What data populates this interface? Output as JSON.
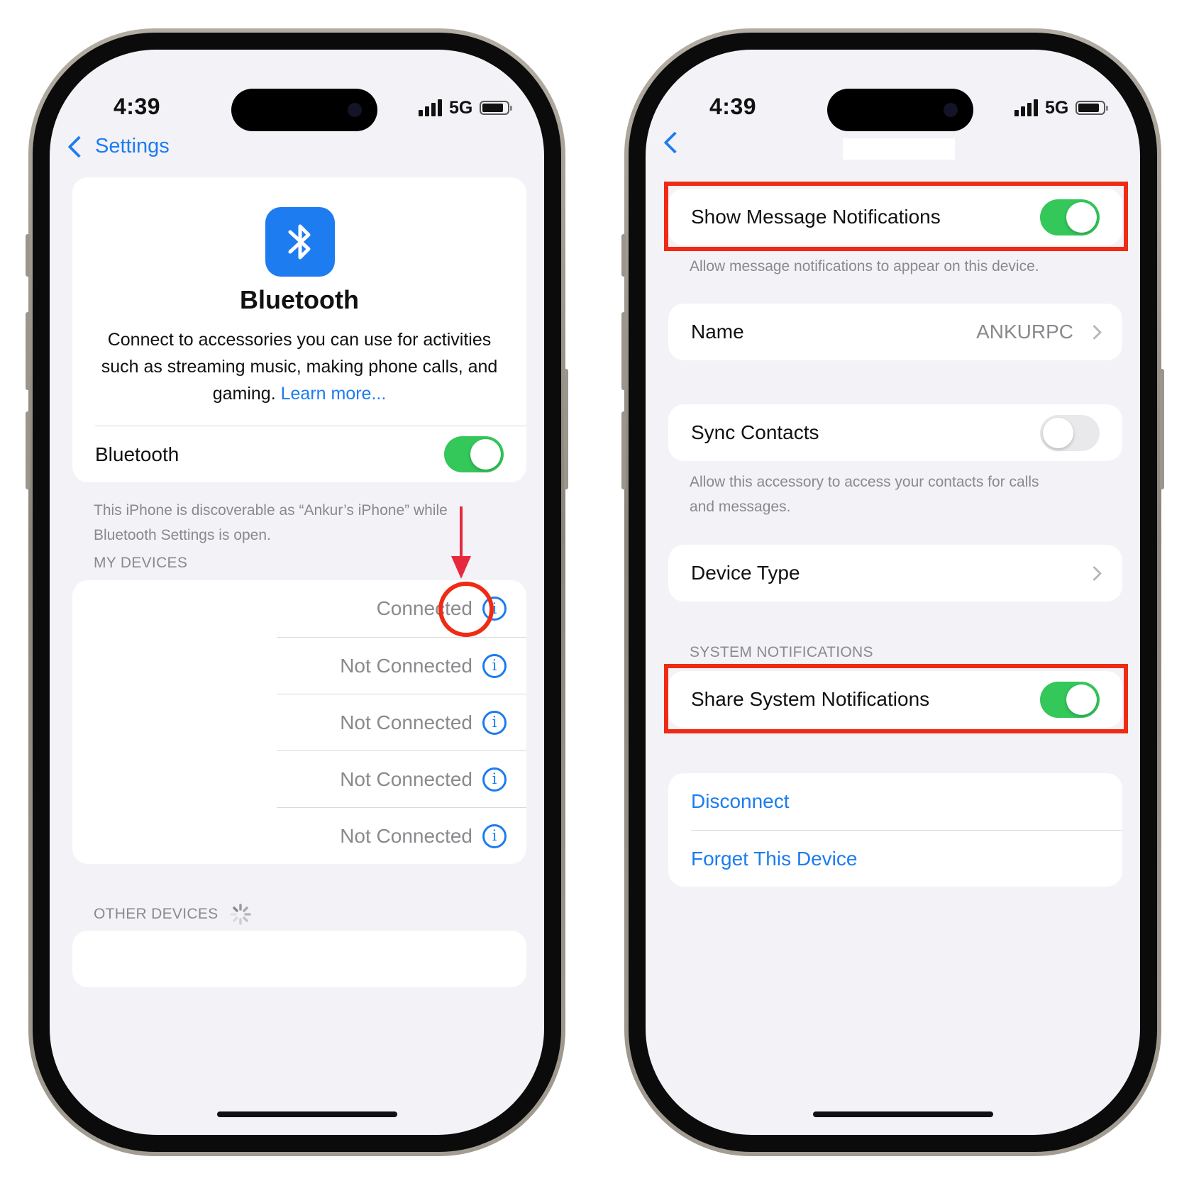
{
  "status": {
    "time": "4:39",
    "network": "5G"
  },
  "left": {
    "back_label": "Settings",
    "hero_title": "Bluetooth",
    "hero_desc_line1": "Connect to accessories you can use for activities",
    "hero_desc_line2": "such as streaming music, making phone calls, and",
    "hero_desc_line3": "gaming.",
    "learn_more": "Learn more...",
    "bluetooth_label": "Bluetooth",
    "bluetooth_on": true,
    "discoverable_line1": "This iPhone is discoverable as “Ankur’s iPhone” while",
    "discoverable_line2": "Bluetooth Settings is open.",
    "my_devices_header": "MY DEVICES",
    "devices": [
      {
        "status": "Connected"
      },
      {
        "status": "Not Connected"
      },
      {
        "status": "Not Connected"
      },
      {
        "status": "Not Connected"
      },
      {
        "status": "Not Connected"
      }
    ],
    "other_devices_header": "OTHER DEVICES"
  },
  "right": {
    "show_notifications_label": "Show Message Notifications",
    "show_notifications_on": true,
    "show_notifications_footer": "Allow message notifications to appear on this device.",
    "name_label": "Name",
    "name_value": "ANKURPC",
    "sync_contacts_label": "Sync Contacts",
    "sync_contacts_on": false,
    "sync_footer_line1": "Allow this accessory to access your contacts for calls",
    "sync_footer_line2": "and messages.",
    "device_type_label": "Device Type",
    "system_notifications_header": "SYSTEM NOTIFICATIONS",
    "share_system_label": "Share System Notifications",
    "share_system_on": true,
    "disconnect_label": "Disconnect",
    "forget_label": "Forget This Device"
  },
  "colors": {
    "accent": "#1c7cf0",
    "toggle_on": "#34c759",
    "highlight": "#ef2b14",
    "annotation_arrow": "#e8283c"
  }
}
